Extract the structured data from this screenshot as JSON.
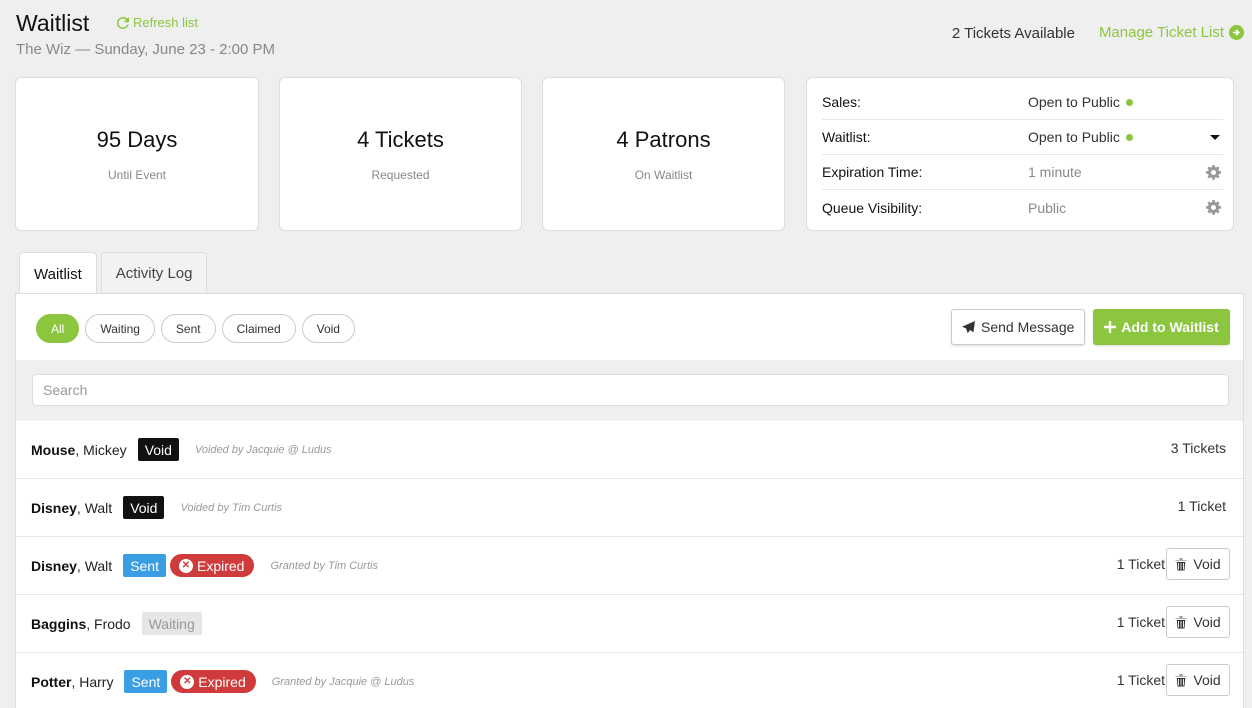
{
  "header": {
    "title": "Waitlist",
    "refresh_label": "Refresh list",
    "subtitle": "The Wiz — Sunday, June 23 - 2:00 PM",
    "tickets_available": "2 Tickets Available",
    "manage_label": "Manage Ticket List"
  },
  "stats": [
    {
      "value": "95 Days",
      "label": "Until Event"
    },
    {
      "value": "4 Tickets",
      "label": "Requested"
    },
    {
      "value": "4 Patrons",
      "label": "On Waitlist"
    }
  ],
  "settings": [
    {
      "label": "Sales:",
      "value": "Open to Public",
      "status_dot": true
    },
    {
      "label": "Waitlist:",
      "value": "Open to Public",
      "status_dot": true,
      "control": "caret-down-icon"
    },
    {
      "label": "Expiration Time:",
      "value": "1 minute",
      "control": "gear-icon"
    },
    {
      "label": "Queue Visibility:",
      "value": "Public",
      "control": "gear-icon"
    }
  ],
  "tabs": [
    "Waitlist",
    "Activity Log"
  ],
  "filters": [
    "All",
    "Waiting",
    "Sent",
    "Claimed",
    "Void"
  ],
  "actions": {
    "send_message": "Send Message",
    "add_to_waitlist": "Add to Waitlist"
  },
  "search": {
    "placeholder": "Search"
  },
  "entries": [
    {
      "last": "Mouse",
      "first": ", Mickey",
      "status": "Void",
      "expired": "",
      "note": "Voided by Jacquie @ Ludus",
      "count": "3 Tickets",
      "void_btn": ""
    },
    {
      "last": "Disney",
      "first": ", Walt",
      "status": "Void",
      "expired": "",
      "note": "Voided by Tim Curtis",
      "count": "1 Ticket",
      "void_btn": ""
    },
    {
      "last": "Disney",
      "first": ", Walt",
      "status": "Sent",
      "expired": "Expired",
      "note": "Granted by Tim Curtis",
      "count": "1 Ticket",
      "void_btn": "Void"
    },
    {
      "last": "Baggins",
      "first": ", Frodo",
      "status": "Waiting",
      "expired": "",
      "note": "",
      "count": "1 Ticket",
      "void_btn": "Void"
    },
    {
      "last": "Potter",
      "first": ", Harry",
      "status": "Sent",
      "expired": "Expired",
      "note": "Granted by Jacquie @ Ludus",
      "count": "1 Ticket",
      "void_btn": "Void"
    }
  ],
  "colors": {
    "accent": "#8cc63f",
    "sent": "#3a9ee4",
    "expired": "#cf3b3b",
    "void": "#111111"
  }
}
